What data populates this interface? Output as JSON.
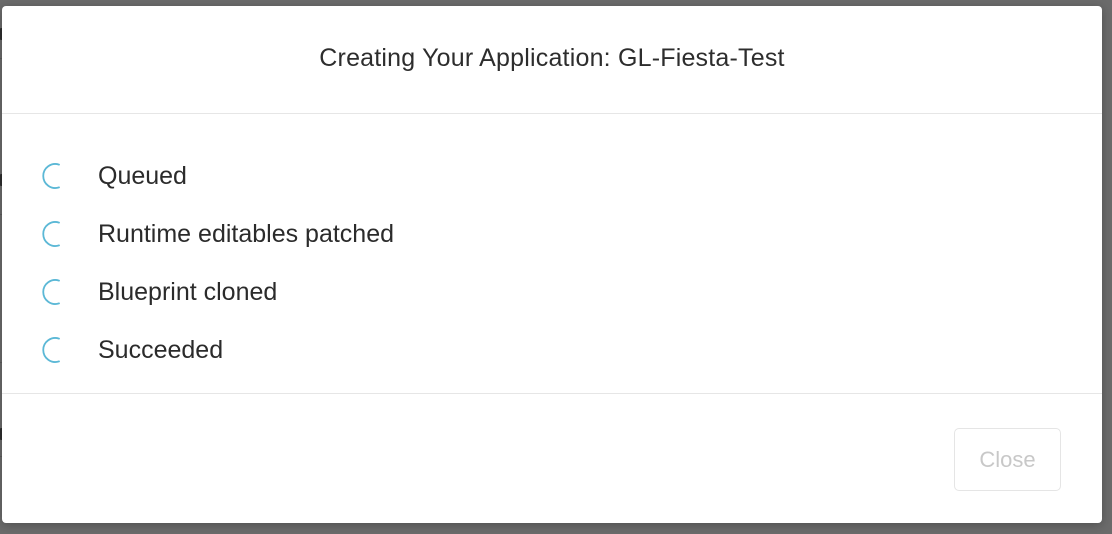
{
  "modal": {
    "title": "Creating Your Application: GL-Fiesta-Test",
    "steps": [
      {
        "label": "Queued",
        "status_icon": "spinner-icon"
      },
      {
        "label": "Runtime editables patched",
        "status_icon": "spinner-icon"
      },
      {
        "label": "Blueprint cloned",
        "status_icon": "spinner-icon"
      },
      {
        "label": "Succeeded",
        "status_icon": "spinner-icon"
      }
    ],
    "close_label": "Close"
  },
  "colors": {
    "spinner": "#5bb8d6",
    "backdrop": "#6b6b6b",
    "disabled_text": "#c8c8c8"
  }
}
